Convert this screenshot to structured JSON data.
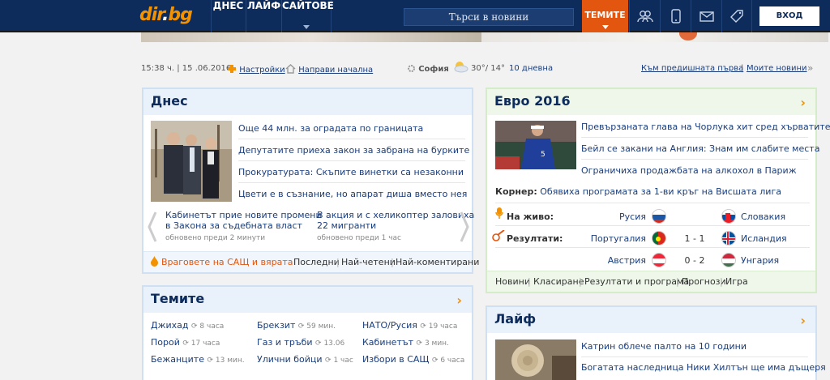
{
  "nav": {
    "logo_main": "dir",
    "logo_dot": ".",
    "logo_tld": "bg",
    "items": [
      "ДНЕС",
      "ЛАЙФ",
      "САЙТОВЕ"
    ],
    "search_placeholder": "Търси в новини",
    "temite": "ТЕМИТЕ",
    "login": "ВХОД",
    "icons": [
      "users-icon",
      "mobile-icon",
      "mail-icon",
      "tag-icon"
    ]
  },
  "infobar": {
    "time": "15:38 ч. | 15 .06.2016",
    "settings": "Настройки",
    "homepage": "Направи начална",
    "city": "София",
    "temp": "30°/ 14°",
    "forecast": "10 дневна",
    "prev_front": "Към предишната първа",
    "separator": "|",
    "my_news": "Моите новини"
  },
  "dnes": {
    "title": "Днес",
    "headlines": [
      "Още 44 млн. за оградата по границата",
      "Депутатите приеха закон за забрана на бурките",
      "Прокуратурата: Скъпите винетки са незаконни",
      "Цвети е в съзнание, но апарат диша вместо нея"
    ],
    "carousel": [
      {
        "title_l1": "Кабинетът прие новите промени",
        "title_l2": "в Закона за съдебната власт",
        "updated": "обновено преди 2 минути"
      },
      {
        "title_l1": "В акция и с хеликоптер заловиха",
        "title_l2": "22 мигранти",
        "updated": "обновено преди 1 час"
      }
    ],
    "footer_hot": "Враговете на САЩ и вярата",
    "tabs": [
      "Последни",
      "Най-четени",
      "Най-коментирани"
    ]
  },
  "temite": {
    "title": "Темите",
    "topics": [
      {
        "name": "Джихад",
        "time": "8 часа"
      },
      {
        "name": "Брекзит",
        "time": "59 мин."
      },
      {
        "name": "НАТО/Русия",
        "time": "19 часа"
      },
      {
        "name": "Порой",
        "time": "17 часа"
      },
      {
        "name": "Газ и тръби",
        "time": "13.06"
      },
      {
        "name": "Кабинетът",
        "time": "3 мин."
      },
      {
        "name": "Бежанците",
        "time": "13 мин."
      },
      {
        "name": "Улични бойци",
        "time": "1 час"
      },
      {
        "name": "Избори в САЩ",
        "time": "6 часа"
      }
    ]
  },
  "euro": {
    "title": "Евро 2016",
    "headlines": [
      "Превързаната глава на Чорлука хит сред хърватите",
      "Бейл се закани на Англия: Знам им слабите места",
      "Ограничиха продажбата на алкохол в Париж"
    ],
    "korner_label": "Корнер:",
    "korner_text": "Обявиха програмата за 1-ви кръг на Висшата лига",
    "live_label": "На живо:",
    "results_label": "Резултати:",
    "matches": [
      {
        "home": "Русия",
        "score": "",
        "away": "Словакия"
      },
      {
        "home": "Португалия",
        "score": "1 - 1",
        "away": "Исландия"
      },
      {
        "home": "Австрия",
        "score": "0 - 2",
        "away": "Унгария"
      }
    ],
    "tabs": [
      "Новини",
      "Класиране",
      "Резултати и програма",
      "Прогнози",
      "Игра"
    ],
    "tab_separator": "|"
  },
  "laif": {
    "title": "Лайф",
    "headlines": [
      "Катрин облече палто на 10 години",
      "Богатата наследница Ники Хилтън ще има дъщеря"
    ]
  },
  "colors": {
    "nav_bg": "#0d2c5c",
    "accent": "#f39200",
    "temite_bg": "#e2560f",
    "link": "#1a3d7a"
  }
}
